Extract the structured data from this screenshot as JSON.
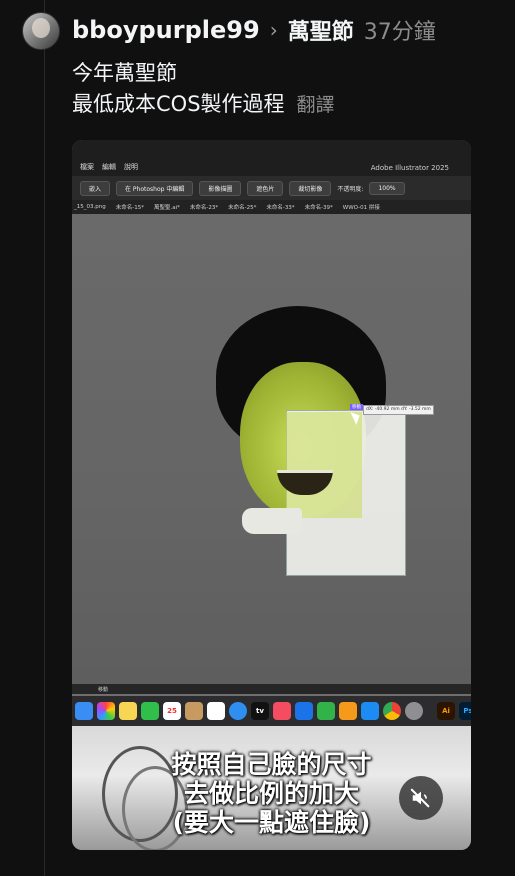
{
  "post": {
    "username": "bboypurple99",
    "topic": "萬聖節",
    "timestamp": "37分鐘",
    "caption_line1": "今年萬聖節",
    "caption_line2": "最低成本COS製作過程",
    "translate_label": "翻譯"
  },
  "video": {
    "illustrator": {
      "menus": [
        "檔案",
        "編輯",
        "說明"
      ],
      "app_title": "Adobe Illustrator 2025",
      "toolbar": {
        "embed_button": "嵌入",
        "photoshop_button": "在 Photoshop 中編輯",
        "trace_button": "影像描圖",
        "mask_button": "遮色片",
        "crop_button": "裁切影像",
        "opacity_label": "不透明度:",
        "opacity_value": "100%"
      },
      "tabs": [
        "_15_03.png",
        "未命名-15*",
        "萬聖聖.ai*",
        "未命名-23*",
        "未命名-25*",
        "未命名-33*",
        "未命名-39*",
        "WWO-01 拼接"
      ],
      "selection_label": "移動",
      "cursor_readout": "dX: -40.92 mm dY: -3.52 mm",
      "status_text": "移動"
    },
    "dock": {
      "icons": [
        "finder-icon",
        "photos-icon",
        "notes-icon",
        "facetime-icon",
        "calendar-icon",
        "contacts-icon",
        "reminders-icon",
        "safari-icon",
        "appletv-icon",
        "music-icon",
        "keynote-icon",
        "numbers-icon",
        "pages-icon",
        "appstore-icon",
        "chrome-icon",
        "settings-icon",
        "illustrator-icon",
        "photoshop-icon"
      ],
      "calendar_day": "25",
      "ai_label": "Ai",
      "ps_label": "Ps",
      "tv_label": "tv"
    },
    "subtitle": {
      "line1": "按照自己臉的尺寸",
      "line2": "去做比例的加大",
      "line3": "(要大一點遮住臉)"
    }
  }
}
